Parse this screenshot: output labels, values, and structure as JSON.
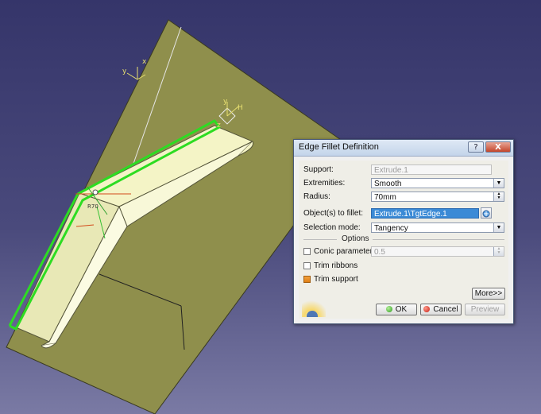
{
  "viewport": {
    "background_top": "#35356a",
    "plane_color": "#8f8f4c",
    "solid_color": "#f5f5c8",
    "highlight_color": "#2ddc22",
    "axis_labels": {
      "main_z": "z",
      "main_y": "y",
      "main_h": "H",
      "small_x": "x",
      "small_y": "y"
    }
  },
  "dialog": {
    "title": "Edge Fillet Definition",
    "help_label": "?",
    "close_label": "X",
    "support": {
      "label": "Support:",
      "value": "Extrude.1"
    },
    "extremities": {
      "label": "Extremities:",
      "value": "Smooth"
    },
    "radius": {
      "label": "Radius:",
      "value": "70mm"
    },
    "objects": {
      "label": "Object(s) to fillet:",
      "value": "Extrude.1\\TgtEdge.1"
    },
    "selection_mode": {
      "label": "Selection mode:",
      "value": "Tangency"
    },
    "options_label": "Options",
    "conic": {
      "label": "Conic parameter:",
      "value": "0.5",
      "checked": false
    },
    "trim_ribbons": {
      "label": "Trim ribbons",
      "checked": false
    },
    "trim_support": {
      "label": "Trim support",
      "checked": true
    },
    "more_label": "More>>",
    "ok_label": "OK",
    "cancel_label": "Cancel",
    "preview_label": "Preview"
  }
}
